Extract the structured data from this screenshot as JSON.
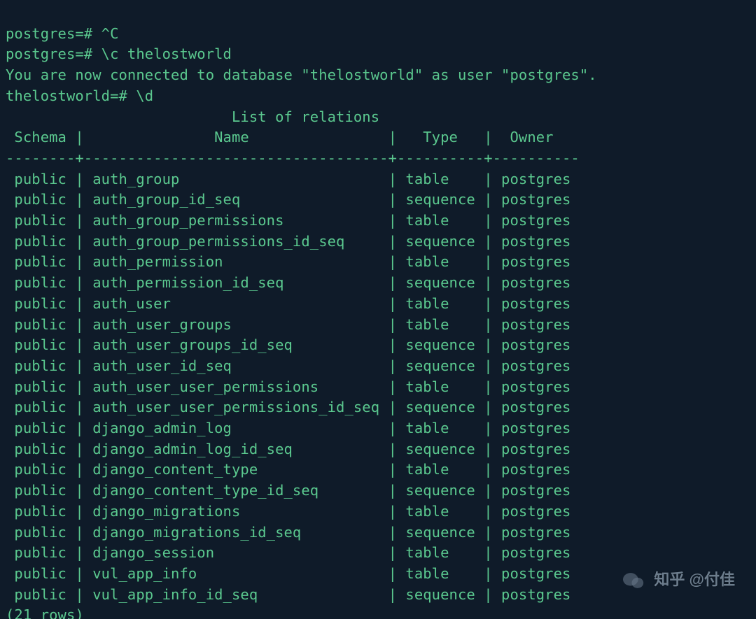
{
  "lines": {
    "line1": "postgres=# ^C",
    "line2": "postgres=# \\c thelostworld",
    "line3": "You are now connected to database \"thelostworld\" as user \"postgres\".",
    "line4": "thelostworld=# \\d"
  },
  "table": {
    "title": "List of relations",
    "headers": {
      "schema": "Schema",
      "name": "Name",
      "type": "Type",
      "owner": "Owner"
    },
    "rows": [
      {
        "schema": "public",
        "name": "auth_group",
        "type": "table",
        "owner": "postgres"
      },
      {
        "schema": "public",
        "name": "auth_group_id_seq",
        "type": "sequence",
        "owner": "postgres"
      },
      {
        "schema": "public",
        "name": "auth_group_permissions",
        "type": "table",
        "owner": "postgres"
      },
      {
        "schema": "public",
        "name": "auth_group_permissions_id_seq",
        "type": "sequence",
        "owner": "postgres"
      },
      {
        "schema": "public",
        "name": "auth_permission",
        "type": "table",
        "owner": "postgres"
      },
      {
        "schema": "public",
        "name": "auth_permission_id_seq",
        "type": "sequence",
        "owner": "postgres"
      },
      {
        "schema": "public",
        "name": "auth_user",
        "type": "table",
        "owner": "postgres"
      },
      {
        "schema": "public",
        "name": "auth_user_groups",
        "type": "table",
        "owner": "postgres"
      },
      {
        "schema": "public",
        "name": "auth_user_groups_id_seq",
        "type": "sequence",
        "owner": "postgres"
      },
      {
        "schema": "public",
        "name": "auth_user_id_seq",
        "type": "sequence",
        "owner": "postgres"
      },
      {
        "schema": "public",
        "name": "auth_user_user_permissions",
        "type": "table",
        "owner": "postgres"
      },
      {
        "schema": "public",
        "name": "auth_user_user_permissions_id_seq",
        "type": "sequence",
        "owner": "postgres"
      },
      {
        "schema": "public",
        "name": "django_admin_log",
        "type": "table",
        "owner": "postgres"
      },
      {
        "schema": "public",
        "name": "django_admin_log_id_seq",
        "type": "sequence",
        "owner": "postgres"
      },
      {
        "schema": "public",
        "name": "django_content_type",
        "type": "table",
        "owner": "postgres"
      },
      {
        "schema": "public",
        "name": "django_content_type_id_seq",
        "type": "sequence",
        "owner": "postgres"
      },
      {
        "schema": "public",
        "name": "django_migrations",
        "type": "table",
        "owner": "postgres"
      },
      {
        "schema": "public",
        "name": "django_migrations_id_seq",
        "type": "sequence",
        "owner": "postgres"
      },
      {
        "schema": "public",
        "name": "django_session",
        "type": "table",
        "owner": "postgres"
      },
      {
        "schema": "public",
        "name": "vul_app_info",
        "type": "table",
        "owner": "postgres"
      },
      {
        "schema": "public",
        "name": "vul_app_info_id_seq",
        "type": "sequence",
        "owner": "postgres"
      }
    ],
    "footer": "(21 rows)"
  },
  "colwidths": {
    "schema": 8,
    "name": 35,
    "type": 10,
    "owner": 10
  },
  "watermark": "知乎 @付佳"
}
